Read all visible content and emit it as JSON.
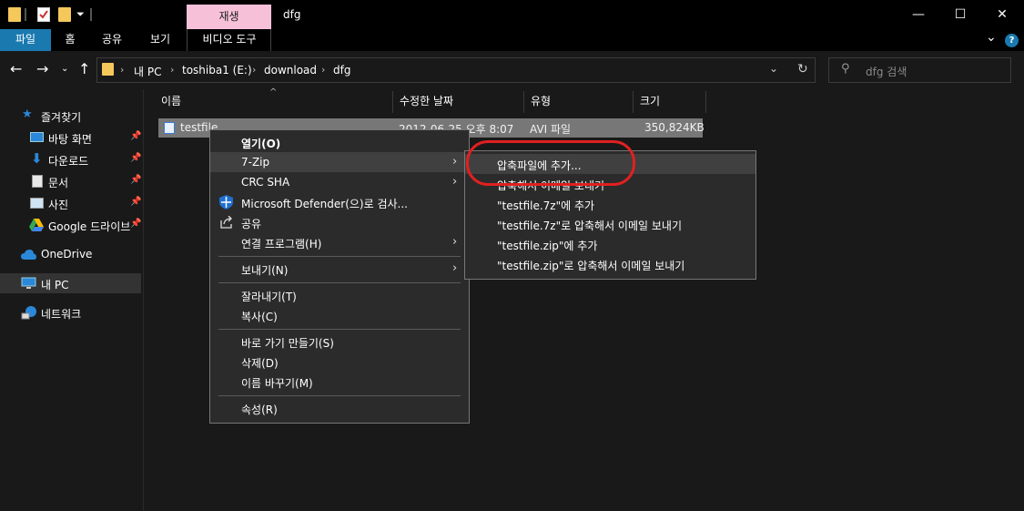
{
  "window": {
    "title": "dfg",
    "contextual_tab": "재생",
    "minimize": "—",
    "maximize": "☐",
    "close": "✕"
  },
  "ribbon": {
    "tabs": [
      "파일",
      "홈",
      "공유",
      "보기",
      "비디오 도구"
    ],
    "collapse": "⌄",
    "help": "?"
  },
  "address": {
    "path": [
      "내 PC",
      "toshiba1 (E:)",
      "download",
      "dfg"
    ],
    "search_placeholder": "dfg 검색"
  },
  "nav": {
    "items": [
      {
        "label": "즐겨찾기",
        "icon": "star-icon"
      },
      {
        "label": "바탕 화면",
        "icon": "desktop-icon",
        "pinned": true
      },
      {
        "label": "다운로드",
        "icon": "download-icon",
        "pinned": true
      },
      {
        "label": "문서",
        "icon": "document-icon",
        "pinned": true
      },
      {
        "label": "사진",
        "icon": "picture-icon",
        "pinned": true
      },
      {
        "label": "Google 드라이브",
        "icon": "google-drive-icon",
        "pinned": true
      },
      {
        "label": "OneDrive",
        "icon": "cloud-icon"
      },
      {
        "label": "내 PC",
        "icon": "computer-icon"
      },
      {
        "label": "네트워크",
        "icon": "network-icon"
      }
    ]
  },
  "columns": [
    "이름",
    "수정한 날짜",
    "유형",
    "크기"
  ],
  "file": {
    "name": "testfile",
    "date": "2012-06-25 오후 8:07",
    "type": "AVI 파일",
    "size": "350,824KB"
  },
  "context_menu": {
    "items": [
      {
        "label": "열기(O)",
        "bold": true
      },
      {
        "label": "7-Zip",
        "submenu": true
      },
      {
        "label": "CRC SHA",
        "submenu": true
      },
      {
        "label": "Microsoft Defender(으)로 검사...",
        "icon": "defender-shield-icon"
      },
      {
        "label": "공유",
        "icon": "share-icon"
      },
      {
        "label": "연결 프로그램(H)",
        "submenu": true
      },
      {
        "label": "보내기(N)",
        "submenu": true
      },
      {
        "label": "잘라내기(T)"
      },
      {
        "label": "복사(C)"
      },
      {
        "label": "바로 가기 만들기(S)"
      },
      {
        "label": "삭제(D)"
      },
      {
        "label": "이름 바꾸기(M)"
      },
      {
        "label": "속성(R)"
      }
    ]
  },
  "submenu_7zip": {
    "items": [
      "압축파일에 추가...",
      "압축해서 이메일 보내기",
      "\"testfile.7z\"에 추가",
      "\"testfile.7z\"로 압축해서 이메일 보내기",
      "\"testfile.zip\"에 추가",
      "\"testfile.zip\"로 압축해서 이메일 보내기"
    ]
  },
  "colors": {
    "file_tab": "#1a7ab0",
    "contextual_tab": "#f7c0d9",
    "highlight_circle": "#e02020"
  }
}
